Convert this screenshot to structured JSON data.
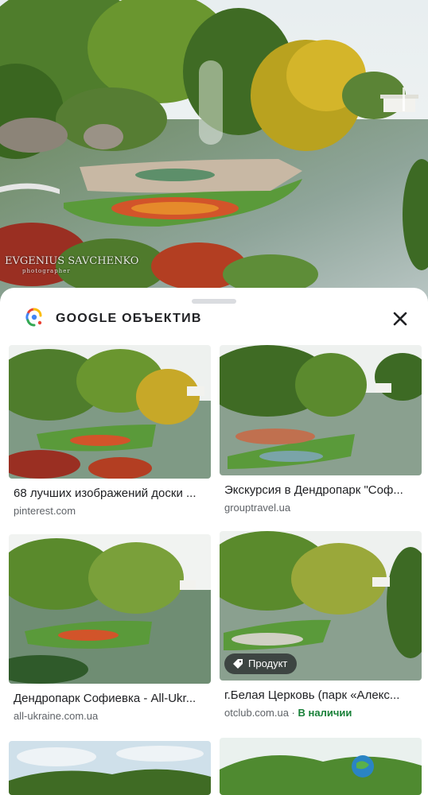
{
  "hero": {
    "watermark_name": "EVGENIUS SAVCHENKO",
    "watermark_sub": "photographer"
  },
  "sheet": {
    "brand": "GOOGLE ОБЪЕКТИВ"
  },
  "results": [
    {
      "title": "68 лучших изображений доски ...",
      "source": "pinterest.com"
    },
    {
      "title": "Экскурсия в Дендропарк \"Соф...",
      "source": "grouptravel.ua"
    },
    {
      "title": "Дендропарк Софиевка - All-Ukr...",
      "source": "all-ukraine.com.ua"
    },
    {
      "title": "г.Белая Церковь (парк «Алекс...",
      "source": "otclub.com.ua",
      "separator": " · ",
      "availability": "В наличии",
      "badge": "Продукт"
    }
  ],
  "colors": {
    "availability_green": "#188038",
    "water": "#5e7d5e",
    "lawn": "#5a9a3a"
  }
}
